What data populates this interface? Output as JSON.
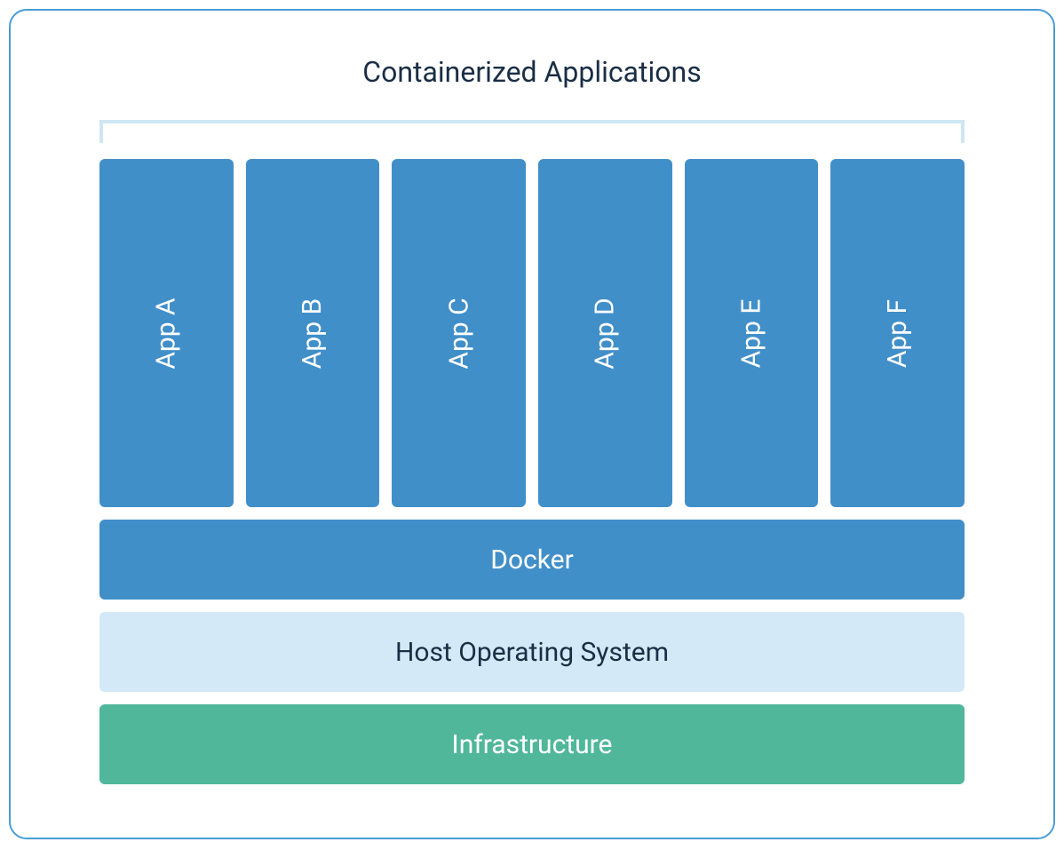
{
  "title": "Containerized Applications",
  "apps": [
    {
      "label": "App A"
    },
    {
      "label": "App B"
    },
    {
      "label": "App C"
    },
    {
      "label": "App D"
    },
    {
      "label": "App E"
    },
    {
      "label": "App F"
    }
  ],
  "layers": {
    "docker": "Docker",
    "host": "Host Operating System",
    "infrastructure": "Infrastructure"
  }
}
